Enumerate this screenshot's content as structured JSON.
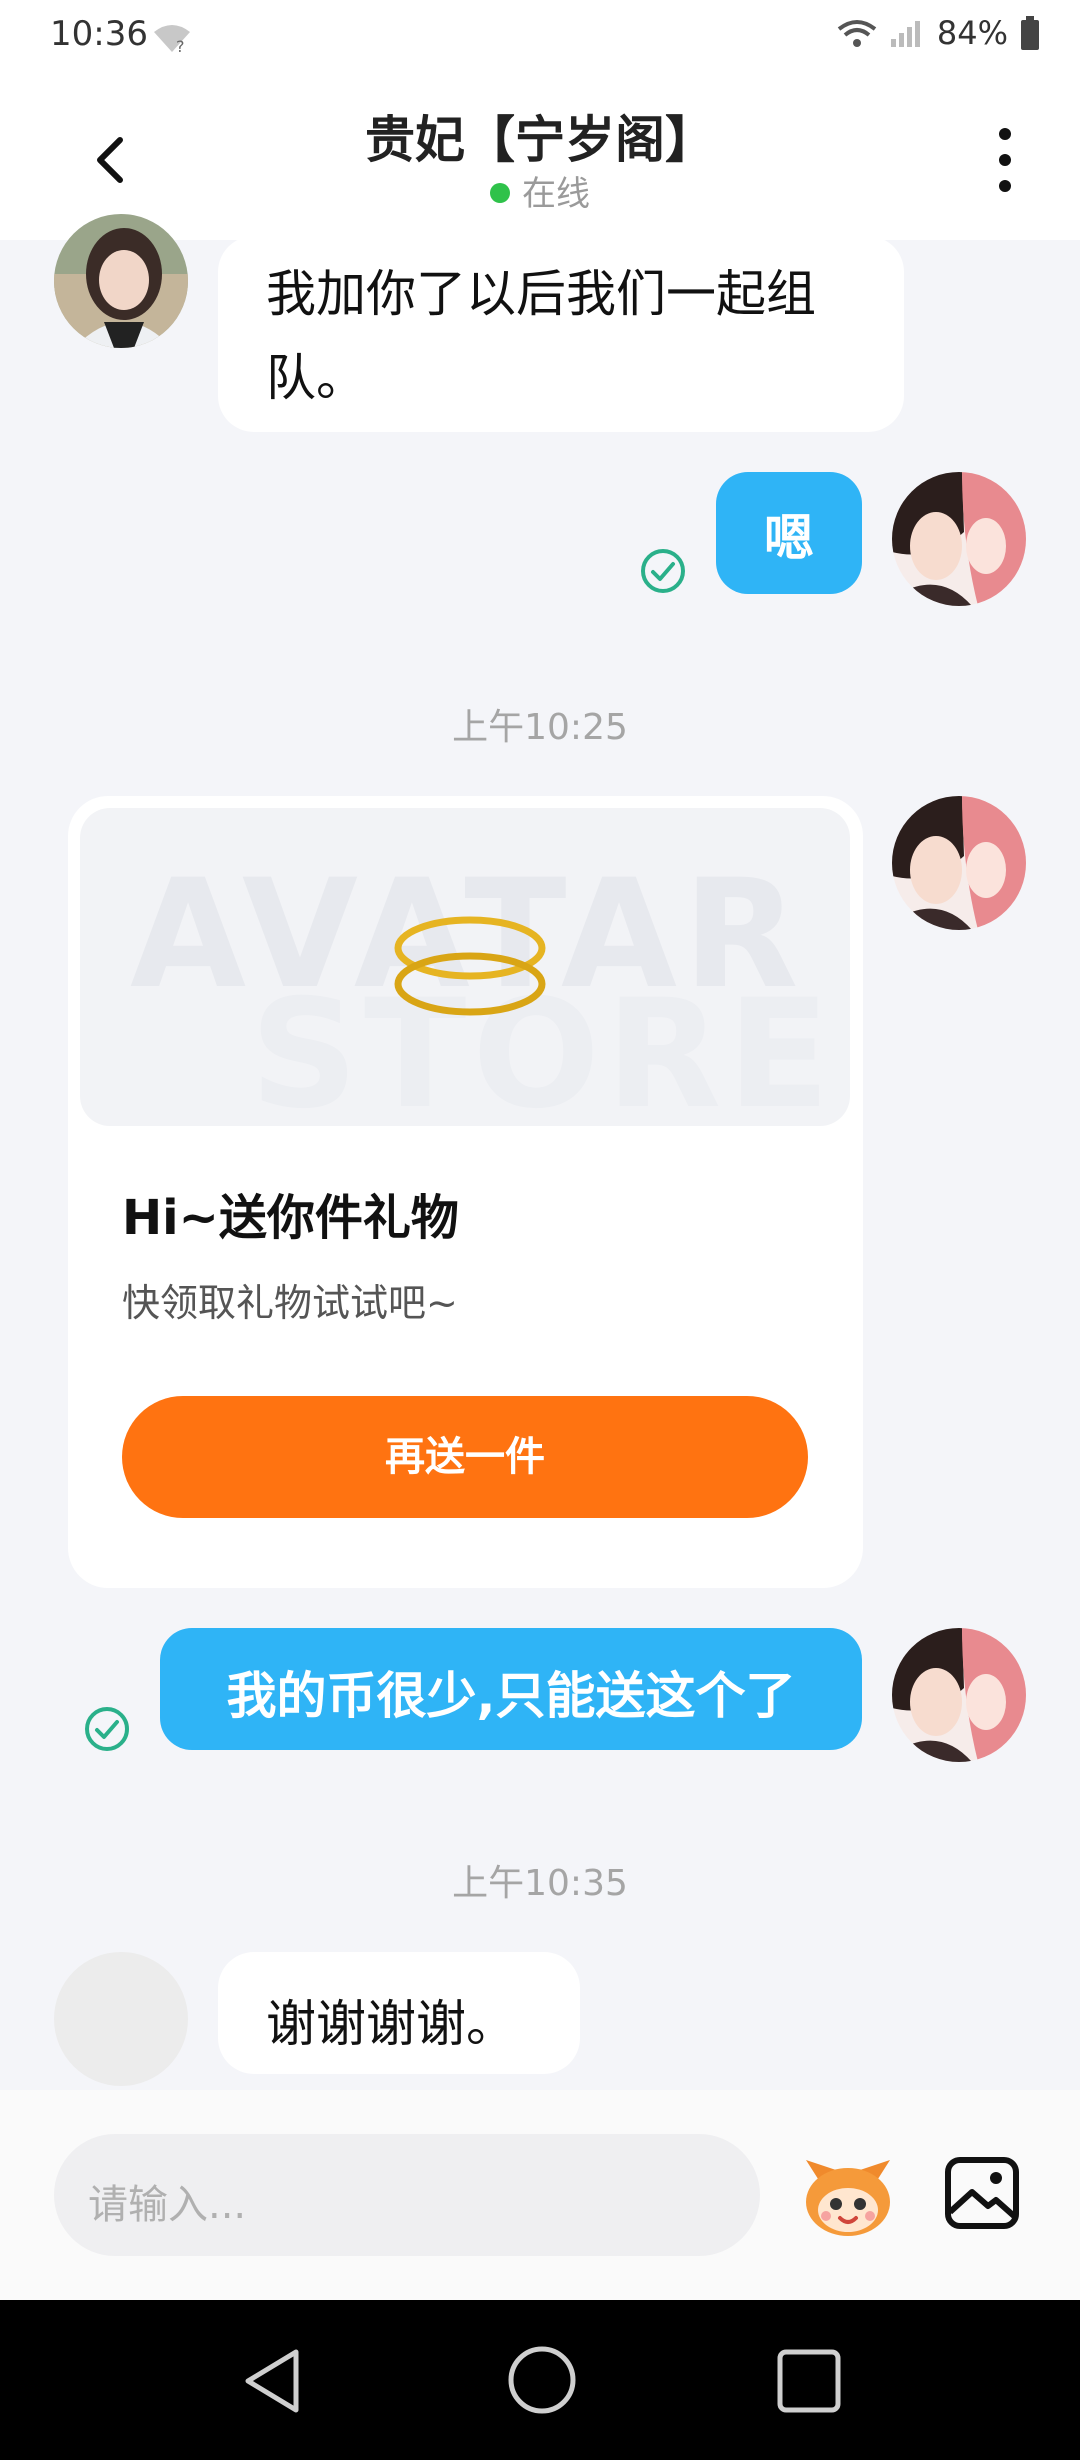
{
  "status_bar": {
    "time": "10:36",
    "battery": "84%"
  },
  "header": {
    "title": "贵妃【宁岁阁】",
    "status": "在线"
  },
  "messages": {
    "m1": "我加你了以后我们一起组队。",
    "m2": "嗯",
    "ts1": "上午10:25",
    "gift_card": {
      "title": "Hi~送你件礼物",
      "subtitle": "快领取礼物试试吧~",
      "button": "再送一件",
      "watermark_line1": "AVATAR",
      "watermark_line2": "STORE"
    },
    "m3": "我的币很少,只能送这个了",
    "ts2": "上午10:35",
    "m4": "谢谢谢谢。"
  },
  "input": {
    "placeholder": "请输入..."
  },
  "colors": {
    "bubble_right": "#2fb4f6",
    "button": "#ff7311",
    "online_dot": "#2fc24a",
    "check": "#2ab08a"
  },
  "icons": [
    "wifi-icon",
    "signal-icon",
    "battery-icon",
    "back-arrow-icon",
    "more-icon",
    "sent-check-icon",
    "ring-gift-icon",
    "mascot-emoji-icon",
    "image-icon",
    "nav-back-icon",
    "nav-home-icon",
    "nav-recents-icon"
  ]
}
